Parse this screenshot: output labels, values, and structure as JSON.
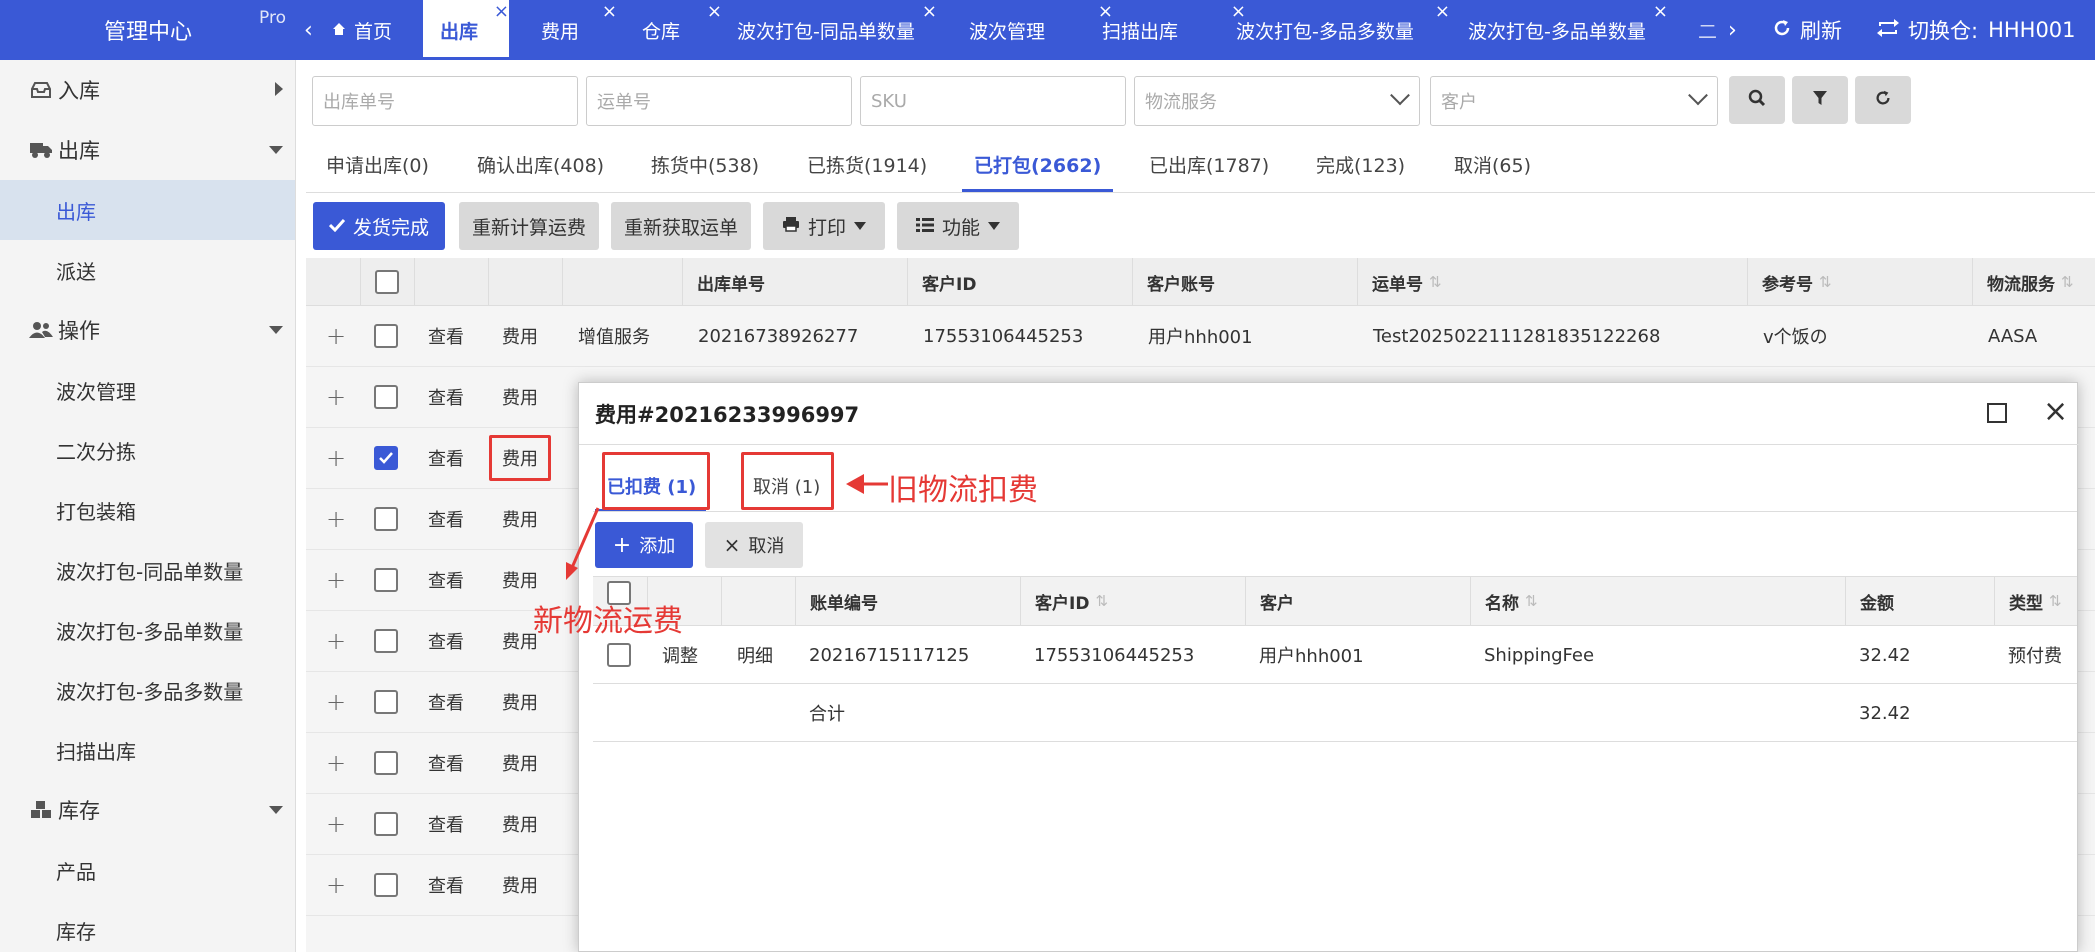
{
  "app": {
    "title": "管理中心",
    "badge": "Pro"
  },
  "sidebar": {
    "items": [
      {
        "label": "入库",
        "type": "group",
        "icon": "inbox-icon"
      },
      {
        "label": "出库",
        "type": "group",
        "icon": "truck-icon"
      },
      {
        "label": "出库",
        "type": "item",
        "active": true
      },
      {
        "label": "派送",
        "type": "item"
      },
      {
        "label": "操作",
        "type": "group",
        "icon": "users-icon"
      },
      {
        "label": "波次管理",
        "type": "item"
      },
      {
        "label": "二次分拣",
        "type": "item"
      },
      {
        "label": "打包装箱",
        "type": "item"
      },
      {
        "label": "波次打包-同品单数量",
        "type": "item"
      },
      {
        "label": "波次打包-多品单数量",
        "type": "item"
      },
      {
        "label": "波次打包-多品多数量",
        "type": "item"
      },
      {
        "label": "扫描出库",
        "type": "item"
      },
      {
        "label": "库存",
        "type": "group",
        "icon": "cubes-icon"
      },
      {
        "label": "产品",
        "type": "item"
      },
      {
        "label": "库存",
        "type": "item"
      }
    ]
  },
  "tabs": [
    {
      "label": "首页"
    },
    {
      "label": "出库"
    },
    {
      "label": "费用"
    },
    {
      "label": "仓库"
    },
    {
      "label": "波次打包-同品单数量"
    },
    {
      "label": "波次管理"
    },
    {
      "label": "扫描出库"
    },
    {
      "label": "波次打包-多品多数量"
    },
    {
      "label": "波次打包-多品单数量"
    },
    {
      "label": "二"
    }
  ],
  "topbar": {
    "refresh": "刷新",
    "switch_warehouse": "切换仓:",
    "warehouse": "HHH001"
  },
  "filters": {
    "outbound_no": "出库单号",
    "waybill_no": "运单号",
    "sku": "SKU",
    "logistics": "物流服务",
    "customer": "客户"
  },
  "status_tabs": [
    "申请出库(0)",
    "确认出库(408)",
    "拣货中(538)",
    "已拣货(1914)",
    "已打包(2662)",
    "已出库(1787)",
    "完成(123)",
    "取消(65)"
  ],
  "actions": {
    "ship_done": "发货完成",
    "recalc_fee": "重新计算运费",
    "reget_waybill": "重新获取运单",
    "print": "打印",
    "functions": "功能"
  },
  "grid": {
    "columns": [
      "出库单号",
      "客户ID",
      "客户账号",
      "运单号",
      "参考号",
      "物流服务"
    ],
    "view": "查看",
    "fee": "费用",
    "vas": "增值服务",
    "rows": [
      {
        "checked": false,
        "outbound_no": "20216738926277",
        "customer_id": "17553106445253",
        "account": "用户hhh001",
        "waybill": "Test20250221112818351222​68",
        "ref": "v个饭の",
        "logistics": "AASA"
      },
      {
        "checked": false
      },
      {
        "checked": true
      },
      {
        "checked": false
      },
      {
        "checked": false
      },
      {
        "checked": false
      },
      {
        "checked": false
      },
      {
        "checked": false
      },
      {
        "checked": false
      },
      {
        "checked": false
      }
    ]
  },
  "modal": {
    "title": "费用#20216233996997",
    "tabs": [
      "已扣费 (1)",
      "取消 (1)"
    ],
    "add": "添加",
    "cancel": "取消",
    "columns": [
      "账单编号",
      "客户ID",
      "客户",
      "名称",
      "金额",
      "类型"
    ],
    "row": {
      "adjust": "调整",
      "detail": "明细",
      "bill_no": "20216715117125",
      "customer_id": "17553106445253",
      "customer": "用户hhh001",
      "name": "ShippingFee",
      "amount": "32.42",
      "type": "预付费"
    },
    "total": {
      "label": "合计",
      "amount": "32.42"
    }
  },
  "annotations": {
    "old_fee": "旧物流扣费",
    "new_fee": "新物流运费"
  },
  "colors": {
    "primary": "#3a59d6",
    "annotation": "#e53935"
  }
}
